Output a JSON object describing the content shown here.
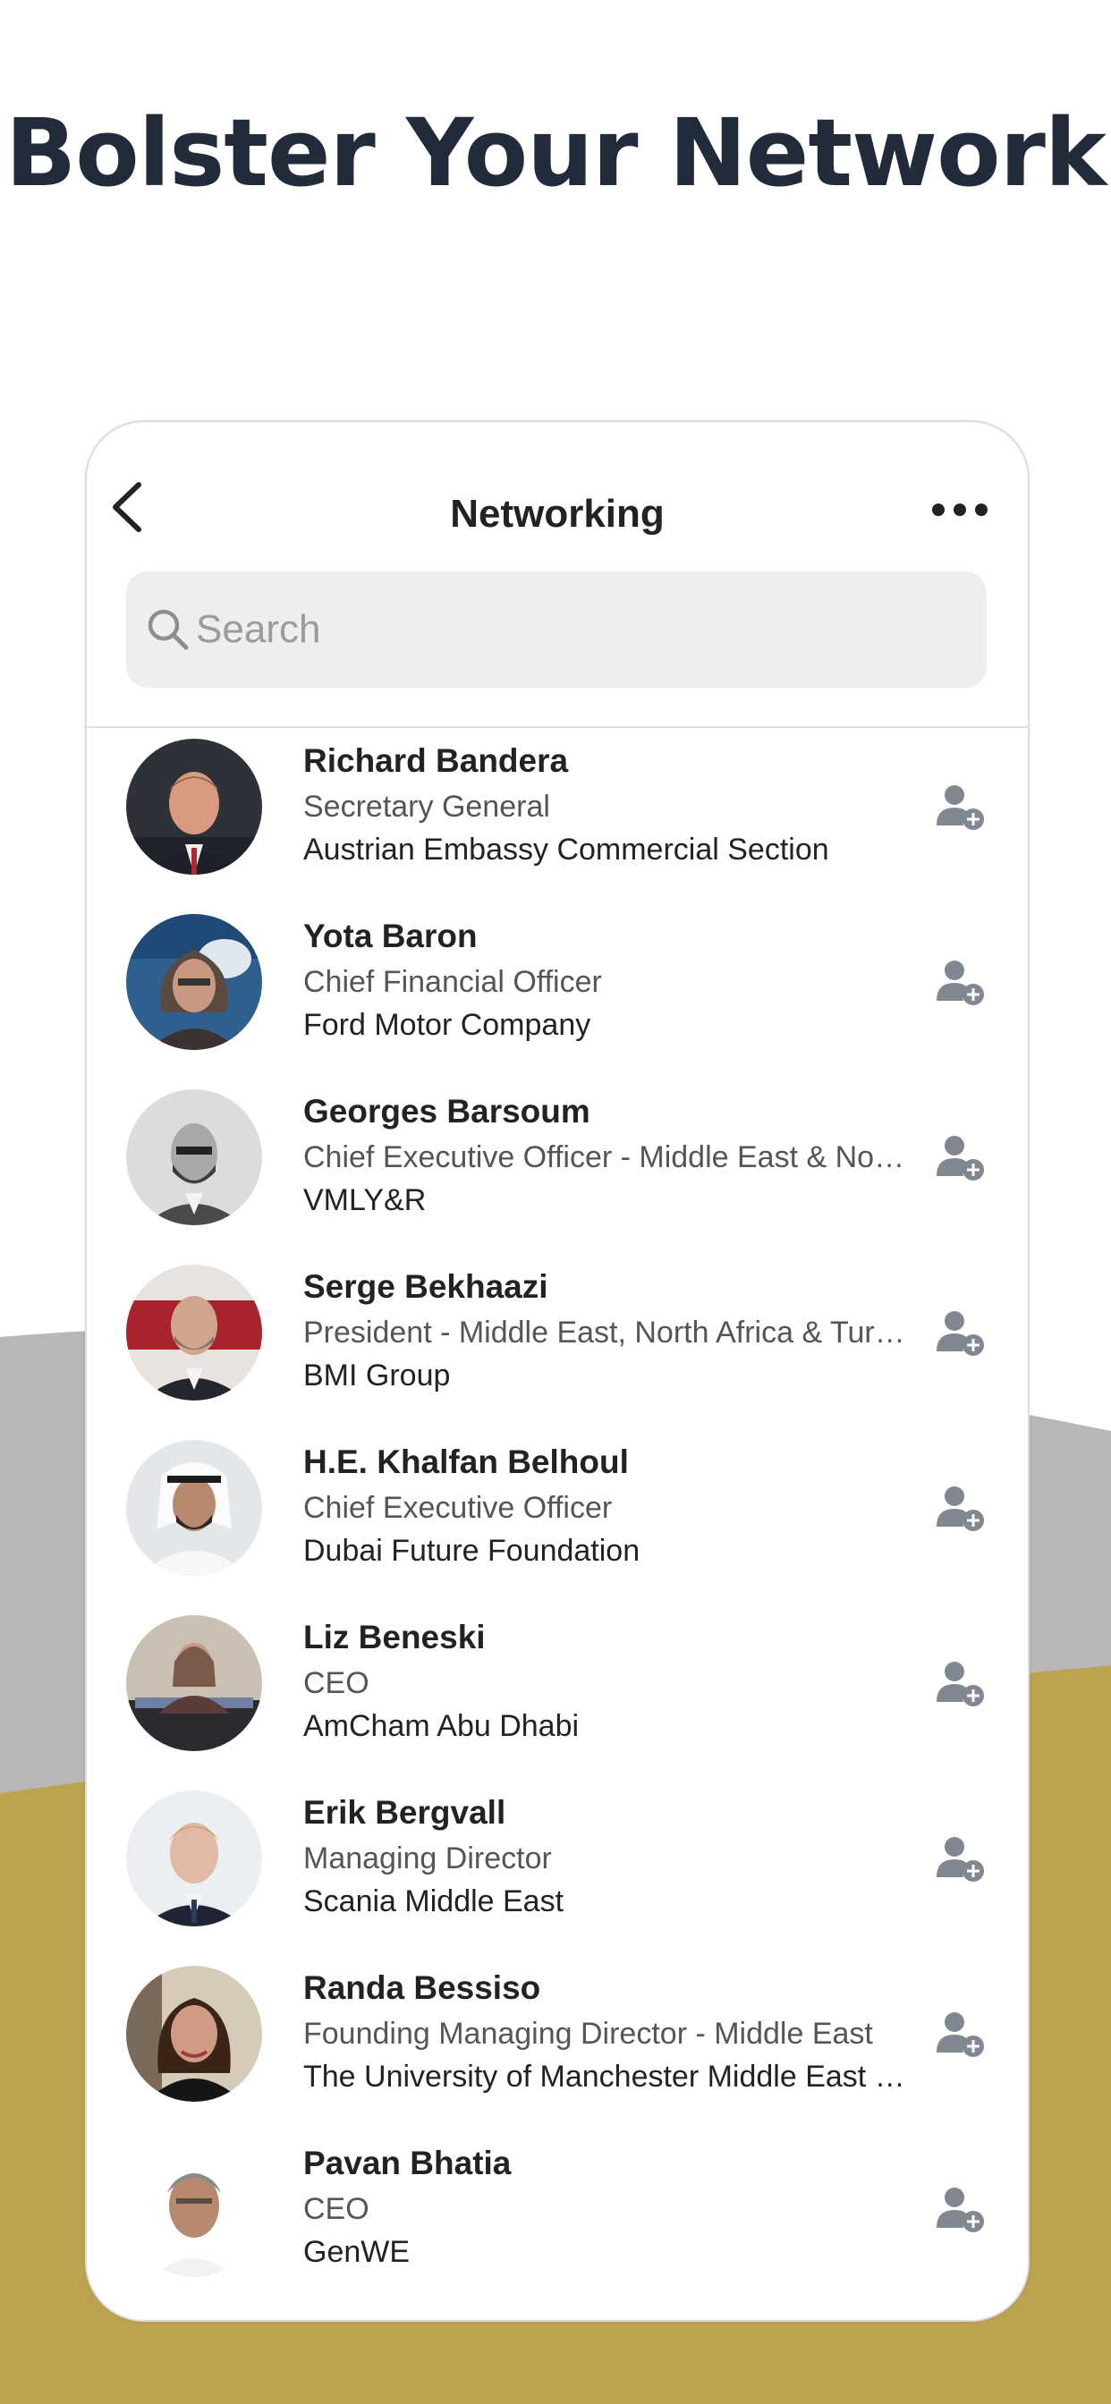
{
  "headline": "Bolster Your Network",
  "colors": {
    "headline": "#222b3a",
    "band_gray": "#b7b6b8",
    "band_gold": "#bda250",
    "action_icon": "#7f8790"
  },
  "nav": {
    "title": "Networking",
    "back_icon": "chevron-left-icon",
    "more_icon": "more-horizontal-icon"
  },
  "search": {
    "placeholder": "Search",
    "value": ""
  },
  "contacts": [
    {
      "name": "Richard Bandera",
      "title": "Secretary General",
      "company": "Austrian Embassy Commercial Section"
    },
    {
      "name": "Yota Baron",
      "title": "Chief Financial Officer",
      "company": "Ford Motor Company"
    },
    {
      "name": "Georges Barsoum",
      "title": "Chief Executive Officer - Middle East & North…",
      "company": "VMLY&R"
    },
    {
      "name": "Serge Bekhaazi",
      "title": "President - Middle East, North Africa & Turkey",
      "company": "BMI Group"
    },
    {
      "name": "H.E. Khalfan Belhoul",
      "title": "Chief Executive Officer",
      "company": "Dubai Future Foundation"
    },
    {
      "name": "Liz Beneski",
      "title": "CEO",
      "company": "AmCham Abu Dhabi"
    },
    {
      "name": "Erik Bergvall",
      "title": "Managing Director",
      "company": "Scania Middle East"
    },
    {
      "name": "Randa Bessiso",
      "title": "Founding Managing Director - Middle East",
      "company": "The University of Manchester Middle East Ce…"
    },
    {
      "name": "Pavan Bhatia",
      "title": "CEO",
      "company": "GenWE"
    }
  ]
}
